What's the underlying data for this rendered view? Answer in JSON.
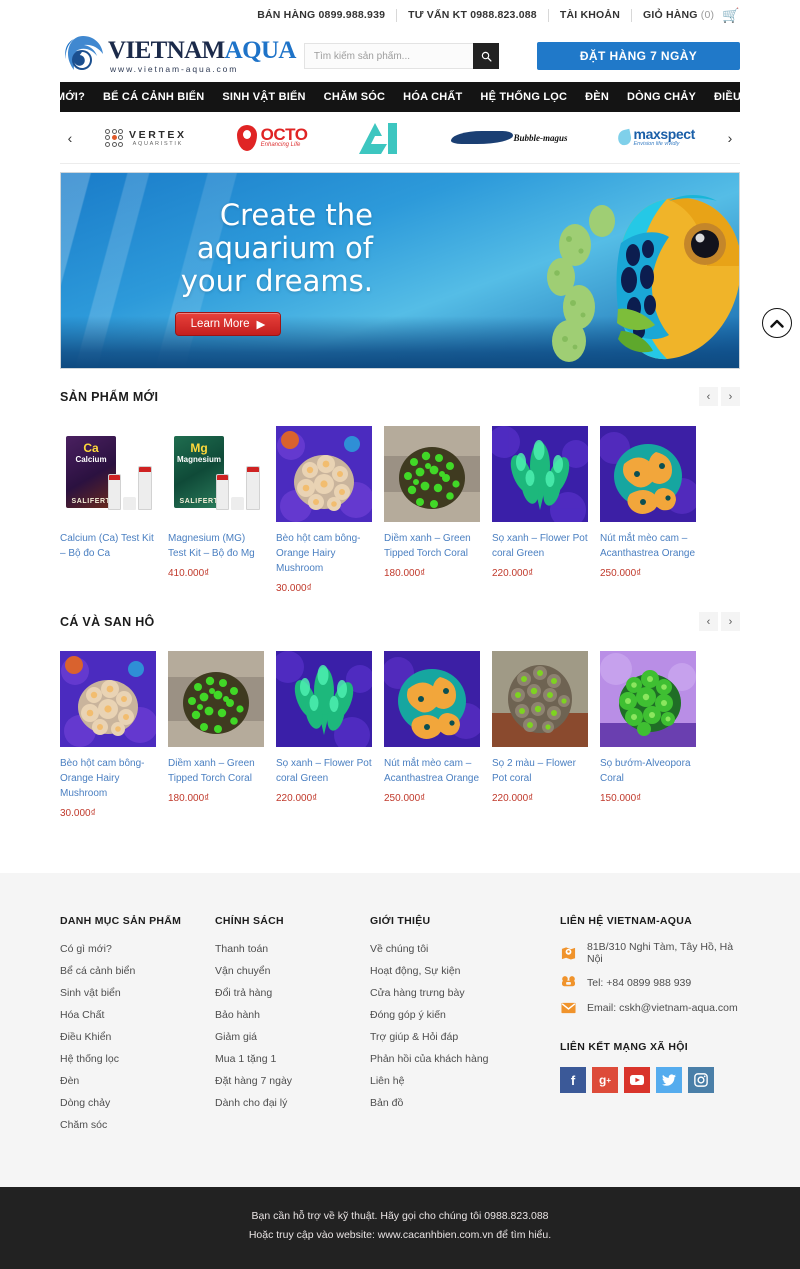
{
  "topbar": {
    "sales_label": "BÁN HÀNG 0899.988.939",
    "consult_label": "TƯ VẤN KT 0988.823.088",
    "account_label": "TÀI KHOẢN",
    "cart_label": "GIỎ HÀNG",
    "cart_count": "(0)",
    "cart_icon": "shopping-cart-icon"
  },
  "header": {
    "logo_name_dark": "VIETNAM",
    "logo_name_blue": "AQUA",
    "logo_url": "www.vietnam-aqua.com",
    "search_placeholder": "Tìm kiếm sản phẩm...",
    "search_value": "",
    "search_icon": "search-icon",
    "order_button": "ĐẶT HÀNG 7 NGÀY",
    "accent_blue": "#2079c9"
  },
  "nav": {
    "items": [
      {
        "label": "CÓ GÌ MỚI?"
      },
      {
        "label": "BỂ CÁ CẢNH BIỂN"
      },
      {
        "label": "SINH VẬT BIỂN"
      },
      {
        "label": "CHĂM SÓC"
      },
      {
        "label": "HÓA CHẤT"
      },
      {
        "label": "HỆ THỐNG LỌC"
      },
      {
        "label": "ĐÈN"
      },
      {
        "label": "DÒNG CHẢY"
      },
      {
        "label": "ĐIỀU KHIỂN"
      }
    ]
  },
  "brands": {
    "prev_icon": "chevron-left-icon",
    "next_icon": "chevron-right-icon",
    "items": [
      {
        "name": "VERTEX",
        "sub": "AQUARISTIK"
      },
      {
        "name": "OCTO",
        "sub": "Enhancing Life"
      },
      {
        "name": "AI",
        "sub": ""
      },
      {
        "name": "Bubble-magus",
        "sub": ""
      },
      {
        "name": "maxspect",
        "sub": "Envision life vividly"
      }
    ]
  },
  "hero": {
    "line1": "Create the",
    "line2": "aquarium of",
    "line3": "your dreams.",
    "cta": "Learn More",
    "cta_icon": "play-triangle-icon"
  },
  "scrolltop": {
    "icon": "chevron-up-icon"
  },
  "sections": [
    {
      "title": "SẢN PHẨM MỚI",
      "prev_icon": "chevron-left-icon",
      "next_icon": "chevron-right-icon",
      "products": [
        {
          "name": "Calcium (Ca) Test Kit – Bộ đo Ca",
          "price": "",
          "art": "ca-test-kit"
        },
        {
          "name": "Magnesium (MG) Test Kit – Bộ đo Mg",
          "price": "410.000₫",
          "art": "mg-test-kit"
        },
        {
          "name": "Bèo hột cam bông- Orange Hairy Mushroom",
          "price": "30.000₫",
          "art": "coral-mushroom"
        },
        {
          "name": "Diềm xanh – Green Tipped Torch Coral",
          "price": "180.000₫",
          "art": "coral-torch"
        },
        {
          "name": "Sọ xanh – Flower Pot coral Green",
          "price": "220.000₫",
          "art": "coral-flowerpot"
        },
        {
          "name": "Nút mắt mèo cam – Acanthastrea Orange",
          "price": "250.000₫",
          "art": "coral-acan"
        }
      ]
    },
    {
      "title": "CÁ VÀ SAN HÔ",
      "prev_icon": "chevron-left-icon",
      "next_icon": "chevron-right-icon",
      "products": [
        {
          "name": "Bèo hột cam bông- Orange Hairy Mushroom",
          "price": "30.000₫",
          "art": "coral-mushroom"
        },
        {
          "name": "Diềm xanh – Green Tipped Torch Coral",
          "price": "180.000₫",
          "art": "coral-torch2"
        },
        {
          "name": "Sọ xanh – Flower Pot coral Green",
          "price": "220.000₫",
          "art": "coral-flowerpot"
        },
        {
          "name": "Nút mắt mèo cam – Acanthastrea Orange",
          "price": "250.000₫",
          "art": "coral-acan"
        },
        {
          "name": "Sọ 2 màu – Flower Pot coral",
          "price": "220.000₫",
          "art": "coral-two-tone"
        },
        {
          "name": "Sọ bướm-Alveopora Coral",
          "price": "150.000₫",
          "art": "coral-alveopora"
        }
      ]
    }
  ],
  "footer": {
    "col1": {
      "heading": "DANH MỤC SẢN PHẨM",
      "links": [
        "Có gì mới?",
        "Bể cá cảnh biển",
        "Sinh vật biển",
        "Hóa Chất",
        "Điều Khiển",
        "Hệ thống lọc",
        "Đèn",
        "Dòng chảy",
        "Chăm sóc"
      ]
    },
    "col2": {
      "heading": "CHÍNH SÁCH",
      "links": [
        "Thanh toán",
        "Vận chuyển",
        "Đổi trả hàng",
        "Bảo hành",
        "Giảm giá",
        "Mua 1 tặng 1",
        "Đặt hàng 7 ngày",
        "Dành cho đại lý"
      ]
    },
    "col3": {
      "heading": "GIỚI THIỆU",
      "links": [
        "Về chúng tôi",
        "Hoạt động, Sự kiện",
        "Cửa hàng trưng bày",
        "Đóng góp ý kiến",
        "Trợ giúp & Hỏi đáp",
        "Phản hồi của khách hàng",
        "Liên hệ",
        "Bản đồ"
      ]
    },
    "col4": {
      "heading": "LIÊN HỆ VIETNAM-AQUA",
      "address": "81B/310 Nghi Tàm, Tây Hồ, Hà Nội",
      "phone": "Tel: +84 0899 988 939",
      "email": "Email: cskh@vietnam-aqua.com",
      "address_icon": "map-pin-icon",
      "phone_icon": "telephone-icon",
      "email_icon": "envelope-icon",
      "social_heading": "LIÊN KẾT MẠNG XÃ HỘI",
      "socials": [
        {
          "name": "facebook-icon",
          "glyph": "f",
          "color": "#3b5998"
        },
        {
          "name": "google-plus-icon",
          "glyph": "g+",
          "color": "#dd4b39"
        },
        {
          "name": "youtube-icon",
          "glyph": "▶",
          "color": "#d9342b"
        },
        {
          "name": "twitter-icon",
          "glyph": "t",
          "color": "#55acee"
        },
        {
          "name": "instagram-icon",
          "glyph": "◉",
          "color": "#4a7fa8"
        }
      ]
    }
  },
  "bottom": {
    "line1": "Bạn cần hỗ trợ về kỹ thuật. Hãy gọi cho chúng tôi 0988.823.088",
    "line2": "Hoặc truy cập vào website: www.cacanhbien.com.vn để tìm hiểu."
  }
}
